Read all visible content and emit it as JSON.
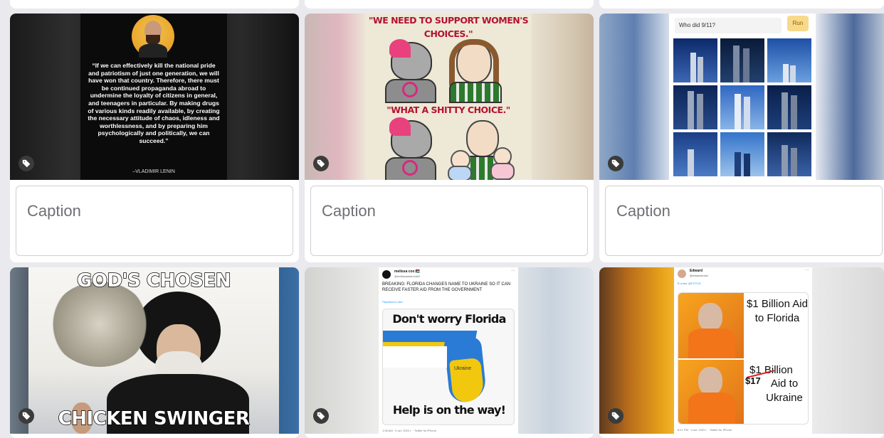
{
  "cards": [
    {
      "caption_placeholder": "Caption",
      "quote": "“If we can effectively kill the national pride and patriotism of just one generation, we will have won that country. Therefore, there must be continued propaganda abroad to undermine the loyalty of citizens in general, and teenagers in particular. By making drugs of various kinds readily available, by creating the necessary attitude of chaos, idleness and worthlessness, and by preparing him psychologically and politically, we can succeed.”",
      "attribution": "–VLADIMIR LENIN"
    },
    {
      "caption_placeholder": "Caption",
      "top_text": "\"WE NEED TO SUPPORT WOMEN'S CHOICES.\"",
      "mid_text": "\"WHAT A SHITTY CHOICE.\""
    },
    {
      "caption_placeholder": "Caption",
      "search_value": "Who did 9/11?",
      "run_label": "Run"
    },
    {
      "top_text": "GOD'S CHOSEN",
      "bottom_text": "CHICKEN SWINGER"
    },
    {
      "user_name": "melissa cox 🇵🇸",
      "user_handle": "@melissaamerica02",
      "tweet_text": "BREAKING: FLORIDA CHANGES NAME TO UKRAINE SO IT CAN RECEIVE FASTER AID FROM THE GOVERNMENT",
      "translate_link": "Перевести твит",
      "image_top": "Don't worry Florida",
      "map_label": "Ukraine",
      "image_bottom": "Help is on the way!",
      "meta": "1:08 AM · 6 окт. 2022 г. · Twitter for iPhone"
    },
    {
      "user_name": "Edward",
      "user_handle": "@edwardrossl",
      "reply_to": "В ответ @POTUS",
      "panel1": "$1 Billion Aid to Florida",
      "panel2_strike": "$1",
      "panel2_rest": "Billion",
      "panel2_new": "$17",
      "panel2_lines": "Aid to Ukraine",
      "meta": "8:47 PM · 4 окт. 2022 г. · Twitter for iPhone"
    }
  ],
  "icons": {
    "tag": "tag-icon"
  }
}
